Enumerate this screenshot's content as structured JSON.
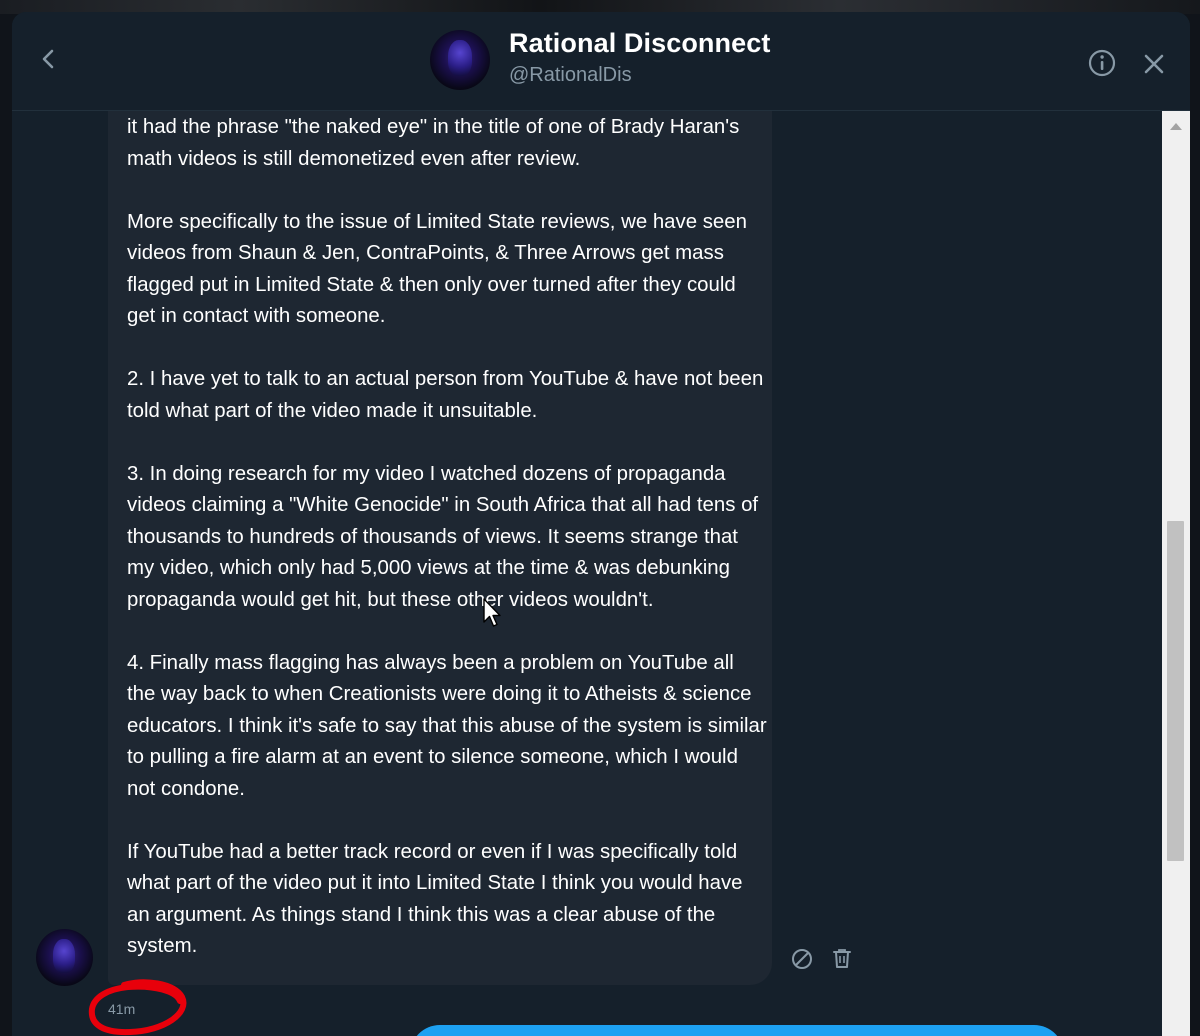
{
  "header": {
    "name": "Rational Disconnect",
    "handle": "@RationalDis",
    "back_icon": "chevron-left-icon",
    "info_icon": "info-icon",
    "close_icon": "close-icon"
  },
  "message": {
    "text": "it had the phrase \"the naked eye\" in the title of one of Brady Haran's math videos is still demonetized even after review.\n\nMore specifically to the issue of Limited State reviews, we have seen videos from Shaun & Jen, ContraPoints, & Three Arrows get mass flagged put in Limited State & then only over turned after they could get in contact with someone.\n\n2. I have yet to talk to an actual person from YouTube & have not been told what part of the video made it unsuitable.\n\n3. In doing research for my video I watched dozens of propaganda videos claiming a \"White Genocide\" in South Africa that all had tens of thousands to hundreds of thousands of views. It seems strange that my video, which only had 5,000 views at the time & was debunking propaganda would get hit, but these other videos wouldn't.\n\n4. Finally mass flagging has always been a problem on YouTube all the way back to when Creationists were doing it to Atheists & science educators. I think it's safe to say that this abuse of the system is similar to pulling a fire alarm at an event to silence someone, which I would not condone.\n\nIf YouTube had a better track record or even if I was specifically told what part of the video put it into Limited State I think you would have an argument. As things stand I think this was a clear abuse of the system.",
    "timestamp": "41m",
    "report_icon": "block-icon",
    "delete_icon": "trash-icon"
  },
  "colors": {
    "background": "#15202b",
    "bubble": "#1e2732",
    "accent": "#1da1f2",
    "muted_text": "#8899a6",
    "annotation": "#e8000b"
  }
}
